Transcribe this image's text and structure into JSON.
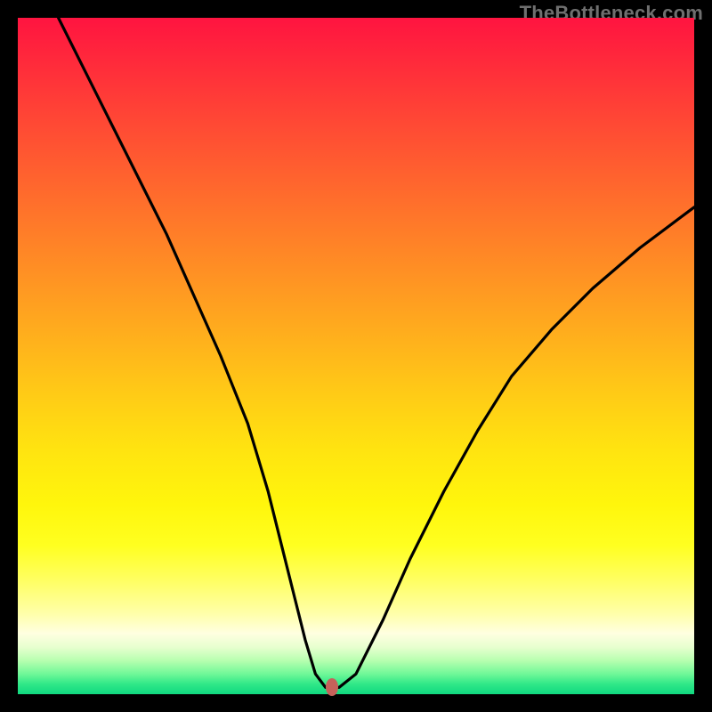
{
  "watermark": "TheBottleneck.com",
  "chart_data": {
    "type": "line",
    "title": "",
    "xlabel": "",
    "ylabel": "",
    "xlim": [
      0,
      100
    ],
    "ylim": [
      0,
      100
    ],
    "grid": false,
    "legend": false,
    "background": "heatmap_gradient",
    "series": [
      {
        "name": "bottleneck-curve",
        "x": [
          6,
          10,
          14,
          18,
          22,
          26,
          30,
          34,
          37,
          39,
          41,
          42.5,
          44,
          45.5,
          47.5,
          50,
          54,
          58,
          63,
          68,
          73,
          79,
          85,
          92,
          100
        ],
        "values": [
          100,
          92,
          84,
          76,
          68,
          59,
          50,
          40,
          30,
          22,
          14,
          8,
          3,
          1,
          1,
          3,
          11,
          20,
          30,
          39,
          47,
          54,
          60,
          66,
          72
        ]
      }
    ],
    "marker": {
      "x": 46.5,
      "y": 1,
      "color": "#c6615a"
    },
    "gradient_stops": [
      {
        "pct": 0,
        "color": "#ff1440"
      },
      {
        "pct": 40,
        "color": "#ff9822"
      },
      {
        "pct": 72,
        "color": "#fff60c"
      },
      {
        "pct": 88,
        "color": "#ffffa8"
      },
      {
        "pct": 95,
        "color": "#b8ffb0"
      },
      {
        "pct": 100,
        "color": "#10d880"
      }
    ]
  }
}
